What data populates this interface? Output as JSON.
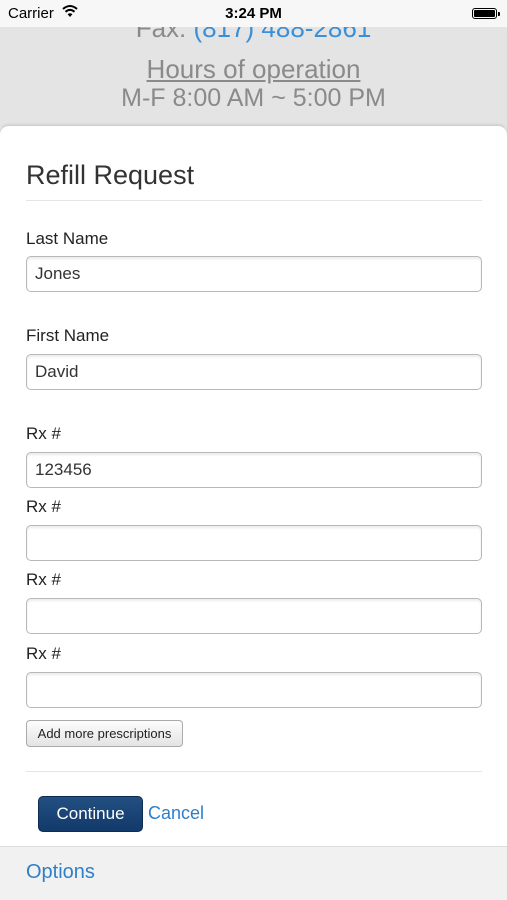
{
  "status_bar": {
    "carrier": "Carrier",
    "time": "3:24 PM",
    "battery_level": 1.0
  },
  "background": {
    "fax_label": "Fax:",
    "fax_number": "(817) 488-2861",
    "hours_title": "Hours of operation",
    "hours_value": "M-F 8:00 AM ~ 5:00 PM"
  },
  "form": {
    "title": "Refill Request",
    "last_name": {
      "label": "Last Name",
      "value": "Jones"
    },
    "first_name": {
      "label": "First Name",
      "value": "David"
    },
    "rx": [
      {
        "label": "Rx #",
        "value": "123456"
      },
      {
        "label": "Rx #",
        "value": ""
      },
      {
        "label": "Rx #",
        "value": ""
      },
      {
        "label": "Rx #",
        "value": ""
      }
    ],
    "add_more_label": "Add more prescriptions",
    "continue_label": "Continue",
    "cancel_label": "Cancel"
  },
  "bottom_bar": {
    "options_label": "Options"
  },
  "colors": {
    "link": "#2f7fc8",
    "primary_button": "#1a4475"
  }
}
